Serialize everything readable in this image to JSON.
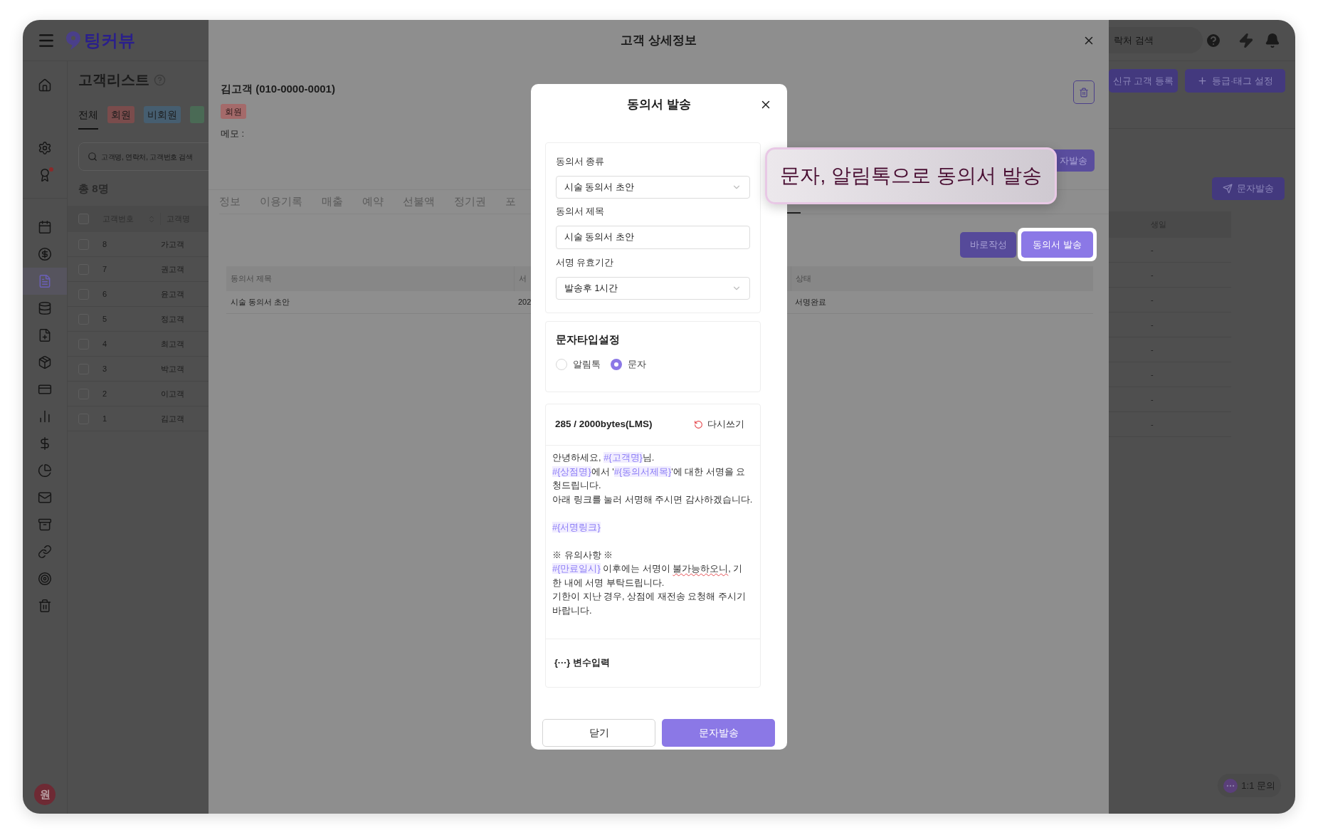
{
  "header": {
    "logo": "팅커뷰",
    "search_placeholder": "락처 검색"
  },
  "sidebar": {
    "groups": [
      [
        {
          "selected": false,
          "notification": false
        }
      ],
      [
        {
          "selected": false,
          "notification": false
        },
        {
          "selected": false,
          "notification": true
        }
      ],
      [
        {
          "selected": false,
          "notification": false
        },
        {
          "selected": false,
          "notification": false
        },
        {
          "selected": true,
          "notification": false
        },
        {
          "selected": false,
          "notification": false
        },
        {
          "selected": false,
          "notification": false
        },
        {
          "selected": false,
          "notification": false
        },
        {
          "selected": false,
          "notification": false
        },
        {
          "selected": false,
          "notification": false
        },
        {
          "selected": false,
          "notification": false
        },
        {
          "selected": false,
          "notification": false
        },
        {
          "selected": false,
          "notification": false
        },
        {
          "selected": false,
          "notification": false
        },
        {
          "selected": false,
          "notification": false
        },
        {
          "selected": false,
          "notification": false
        },
        {
          "selected": false,
          "notification": false
        }
      ]
    ],
    "avatar": "원"
  },
  "customer_list": {
    "title": "고객리스트",
    "filters": [
      {
        "label": "전체",
        "selected": true
      },
      {
        "label": "회원",
        "selected": false,
        "color": "#7a4c4c"
      },
      {
        "label": "비회원",
        "selected": false,
        "color": "#465e70"
      },
      {
        "selected": false,
        "color": "#4a6a55"
      }
    ],
    "search_placeholder": "고객명, 연락처, 고객번호 검색",
    "total": "총 8명",
    "all_checked": false,
    "columns": [
      "고객번호",
      "고객명"
    ],
    "rows": [
      {
        "number": "8",
        "name": "가고객",
        "checked": false
      },
      {
        "number": "7",
        "name": "권고객",
        "checked": false
      },
      {
        "number": "6",
        "name": "윤고객",
        "checked": false
      },
      {
        "number": "5",
        "name": "정고객",
        "checked": false
      },
      {
        "number": "4",
        "name": "최고객",
        "checked": false
      },
      {
        "number": "3",
        "name": "박고객",
        "checked": false
      },
      {
        "number": "2",
        "name": "이고객",
        "checked": false
      },
      {
        "number": "1",
        "name": "김고객",
        "checked": false
      }
    ]
  },
  "right_panel": {
    "buttons": [
      "신규 고객 등록",
      "등급·태그 설정"
    ],
    "message_button": "문자발송",
    "column": "생일",
    "rows": [
      "-",
      "-",
      "-",
      "-",
      "-",
      "-",
      "-",
      "-"
    ],
    "chat": "1:1 문의"
  },
  "detail": {
    "title": "고객 상세정보",
    "customer": "김고객 (010-0000-0001)",
    "tag": {
      "label": "회원",
      "color": "#a46a6a"
    },
    "memo": "메모 :",
    "message_button": "자발송",
    "tabs": [
      {
        "label": "정보",
        "selected": false
      },
      {
        "label": "이용기록",
        "selected": false
      },
      {
        "label": "매출",
        "selected": false
      },
      {
        "label": "예약",
        "selected": false
      },
      {
        "label": "선불액",
        "selected": false
      },
      {
        "label": "정기권",
        "selected": false
      },
      {
        "label": "포",
        "selected": false
      }
    ],
    "actions": [
      {
        "label": "바로작성",
        "highlighted": false
      },
      {
        "label": "동의서 발송",
        "highlighted": true
      }
    ],
    "table": {
      "columns": [
        "동의서 제목",
        "서",
        "상태"
      ],
      "rows": [
        [
          "시술 동의서 초안",
          "202",
          "서명완료"
        ]
      ]
    }
  },
  "modal": {
    "title": "동의서 발송",
    "fields": [
      {
        "label": "동의서 종류",
        "kind": "select",
        "value": "시술 동의서 초안"
      },
      {
        "label": "동의서 제목",
        "kind": "input",
        "value": "시술 동의서 초안"
      },
      {
        "label": "서명 유효기간",
        "kind": "select",
        "value": "발송후 1시간"
      }
    ],
    "message_type": {
      "title": "문자타입설정",
      "options": [
        {
          "label": "알림톡",
          "selected": false
        },
        {
          "label": "문자",
          "selected": true
        }
      ]
    },
    "editor": {
      "counter": "285 / 2000bytes(LMS)",
      "rewrite": "다시쓰기",
      "paragraphs": [
        [
          [
            {
              "text": "안녕하세요, ",
              "kind": "plain"
            },
            {
              "text": "#{고객명}",
              "kind": "variable"
            },
            {
              "text": "님.",
              "kind": "plain"
            }
          ],
          [
            {
              "text": "#{상점명}",
              "kind": "variable"
            },
            {
              "text": "에서 '",
              "kind": "plain"
            },
            {
              "text": "#{동의서제목}",
              "kind": "variable"
            },
            {
              "text": "'에 대한 서명을 요",
              "kind": "plain"
            }
          ],
          [
            {
              "text": "청드립니다.",
              "kind": "plain"
            }
          ],
          [
            {
              "text": "아래 링크를 눌러 서명해 주시면 감사하겠습니다.",
              "kind": "plain"
            }
          ]
        ],
        [
          [
            {
              "text": "#{서명링크}",
              "kind": "variable"
            }
          ]
        ],
        [
          [
            {
              "text": "※ 유의사항 ※",
              "kind": "plain"
            }
          ],
          [
            {
              "text": "#{만료일시}",
              "kind": "variable"
            },
            {
              "text": " 이후에는 서명이 ",
              "kind": "plain"
            },
            {
              "text": "불가능하오니",
              "kind": "misspelled"
            },
            {
              "text": ", 기",
              "kind": "plain"
            }
          ],
          [
            {
              "text": "한 내에 서명 부탁드립니다.",
              "kind": "plain"
            }
          ],
          [
            {
              "text": "기한이 지난 경우, 상점에 재전송 요청해 주시기",
              "kind": "plain"
            }
          ],
          [
            {
              "text": "바랍니다.",
              "kind": "plain"
            }
          ]
        ]
      ],
      "variable_button": "{···} 변수입력"
    },
    "buttons": [
      {
        "label": "닫기",
        "kind": "secondary"
      },
      {
        "label": "문자발송",
        "kind": "primary"
      }
    ]
  },
  "tooltip": {
    "text": "문자, 알림톡으로 동의서 발송"
  }
}
